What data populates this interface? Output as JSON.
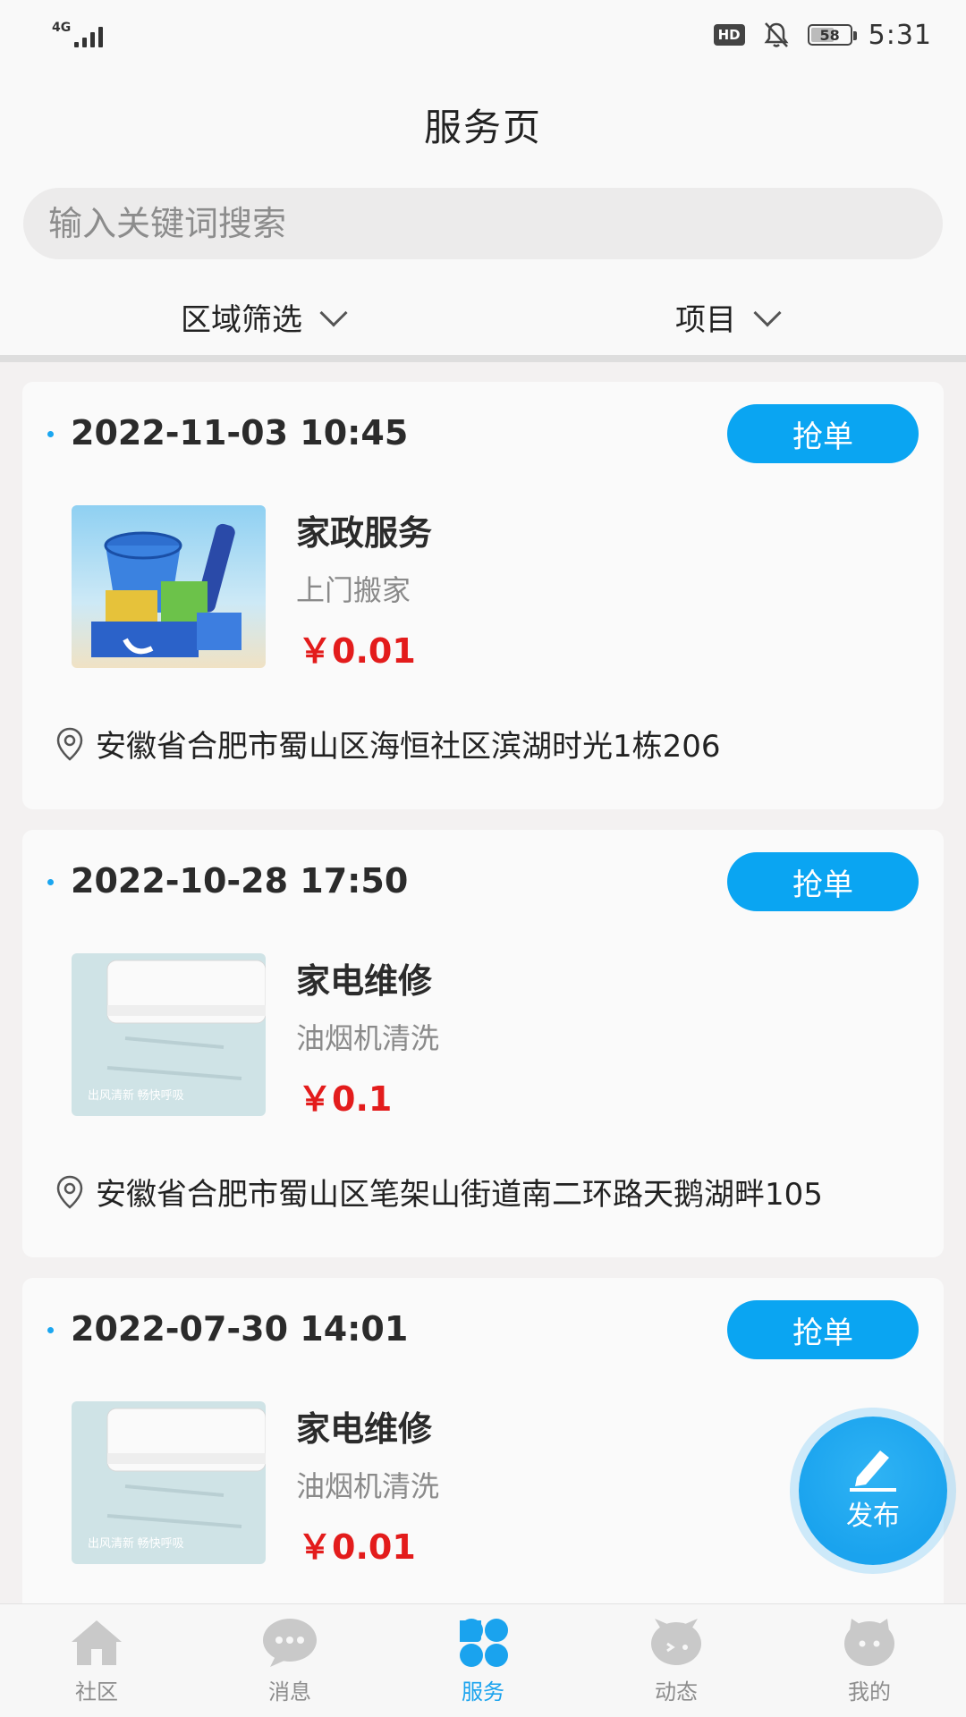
{
  "status_bar": {
    "network": "4G",
    "hd_badge": "HD",
    "battery": "58",
    "time": "5:31"
  },
  "header": {
    "title": "服务页"
  },
  "search": {
    "placeholder": "输入关键词搜索",
    "value": ""
  },
  "filters": {
    "area": {
      "label": "区域筛选",
      "icon": "chevron-down-icon"
    },
    "project": {
      "label": "项目",
      "icon": "chevron-down-icon"
    }
  },
  "orders": [
    {
      "time": "2022-11-03 10:45",
      "button": "抢单",
      "category": "家政服务",
      "service": "上门搬家",
      "price": "￥0.01",
      "address": "安徽省合肥市蜀山区海恒社区滨湖时光1栋206",
      "image": "cleaning-kit-image"
    },
    {
      "time": "2022-10-28 17:50",
      "button": "抢单",
      "category": "家电维修",
      "service": "油烟机清洗",
      "price": "￥0.1",
      "address": "安徽省合肥市蜀山区笔架山街道南二环路天鹅湖畔105",
      "image": "air-conditioner-image",
      "image_caption": "出风清新 畅快呼吸"
    },
    {
      "time": "2022-07-30 14:01",
      "button": "抢单",
      "category": "家电维修",
      "service": "油烟机清洗",
      "price": "￥0.01",
      "address": "",
      "image": "air-conditioner-image",
      "image_caption": "出风清新 畅快呼吸"
    }
  ],
  "fab": {
    "label": "发布",
    "icon": "edit-icon"
  },
  "bottom_nav": [
    {
      "label": "社区",
      "icon": "home-icon",
      "active": false
    },
    {
      "label": "消息",
      "icon": "chat-icon",
      "active": false
    },
    {
      "label": "服务",
      "icon": "services-icon",
      "active": true
    },
    {
      "label": "动态",
      "icon": "activity-icon",
      "active": false
    },
    {
      "label": "我的",
      "icon": "profile-icon",
      "active": false
    }
  ],
  "colors": {
    "accent": "#0aa5f2",
    "price": "#e31c1c",
    "nav_inactive": "#8d8d8d"
  }
}
